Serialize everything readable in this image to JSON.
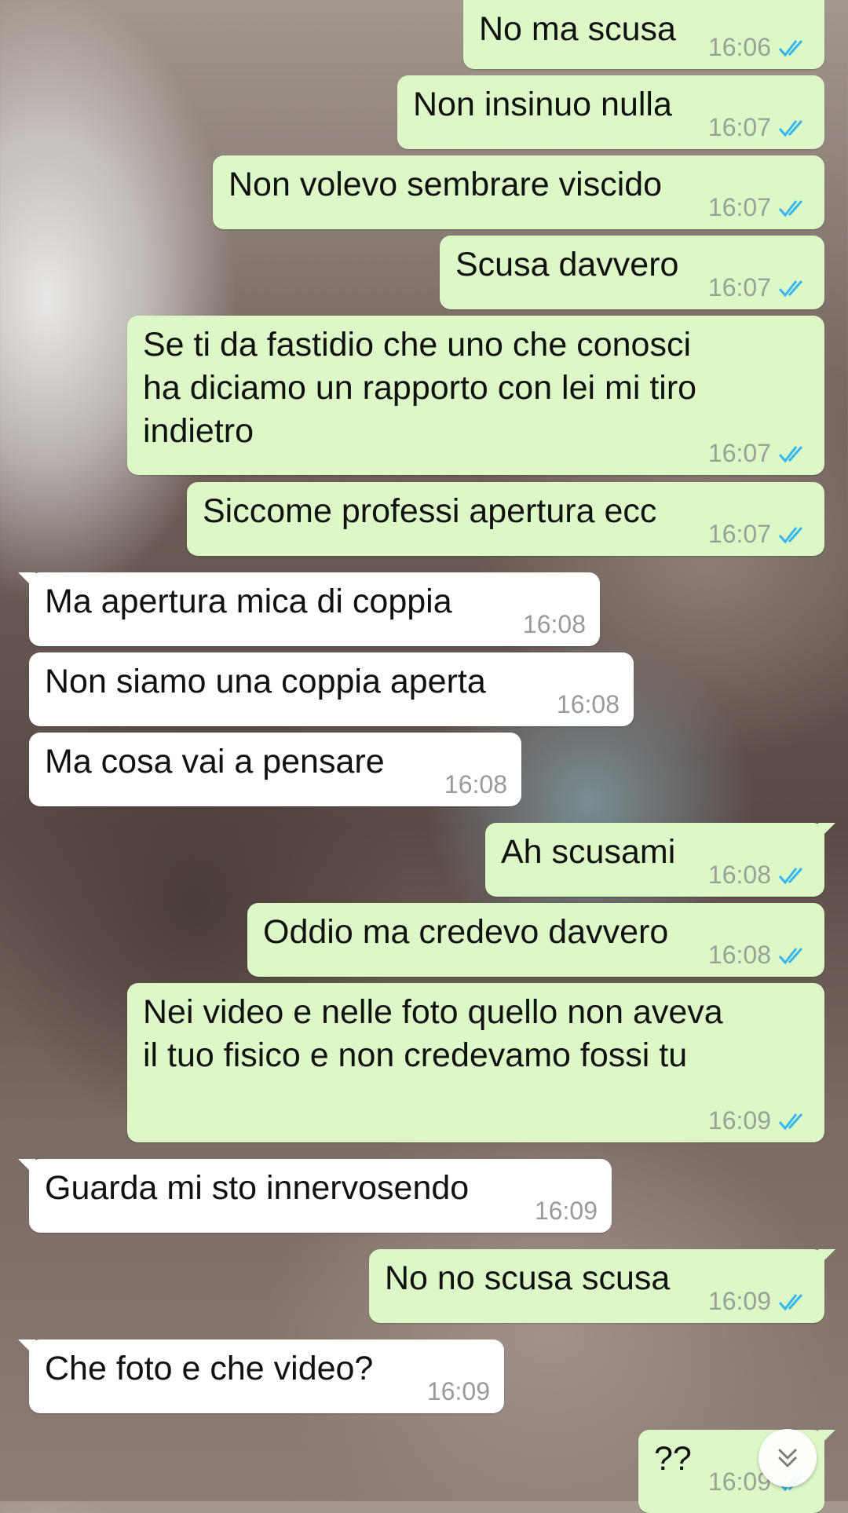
{
  "messages": [
    {
      "dir": "out",
      "text": "No ma scusa",
      "time": "16:06",
      "status": "read"
    },
    {
      "dir": "out",
      "text": "Non insinuo nulla",
      "time": "16:07",
      "status": "read"
    },
    {
      "dir": "out",
      "text": "Non volevo sembrare viscido",
      "time": "16:07",
      "status": "read"
    },
    {
      "dir": "out",
      "text": "Scusa davvero",
      "time": "16:07",
      "status": "read"
    },
    {
      "dir": "out",
      "text": "Se ti da fastidio che uno che conosci\nha diciamo un rapporto con lei mi tiro\nindietro",
      "time": "16:07",
      "status": "read"
    },
    {
      "dir": "out",
      "text": "Siccome professi apertura ecc",
      "time": "16:07",
      "status": "read"
    },
    {
      "dir": "in",
      "text": "Ma apertura mica di coppia",
      "time": "16:08"
    },
    {
      "dir": "in",
      "text": "Non siamo una coppia aperta",
      "time": "16:08"
    },
    {
      "dir": "in",
      "text": "Ma cosa vai a pensare",
      "time": "16:08"
    },
    {
      "dir": "out",
      "text": "Ah scusami",
      "time": "16:08",
      "status": "read"
    },
    {
      "dir": "out",
      "text": "Oddio ma credevo davvero",
      "time": "16:08",
      "status": "read"
    },
    {
      "dir": "out",
      "text": "Nei video e nelle foto quello non aveva\nil tuo fisico e non credevamo fossi tu",
      "time": "16:09",
      "status": "read"
    },
    {
      "dir": "in",
      "text": "Guarda mi sto innervosendo",
      "time": "16:09"
    },
    {
      "dir": "out",
      "text": "No no scusa scusa",
      "time": "16:09",
      "status": "read"
    },
    {
      "dir": "in",
      "text": "Che foto e che video?",
      "time": "16:09"
    },
    {
      "dir": "out",
      "text": "??",
      "time": "16:09",
      "status": "read"
    }
  ],
  "colors": {
    "outgoing": "#dcf8c6",
    "incoming": "#ffffff",
    "read_ticks": "#34b7f1"
  },
  "icons": {
    "read_receipt": "double-check-icon",
    "scroll_down": "double-chevron-down-icon"
  }
}
